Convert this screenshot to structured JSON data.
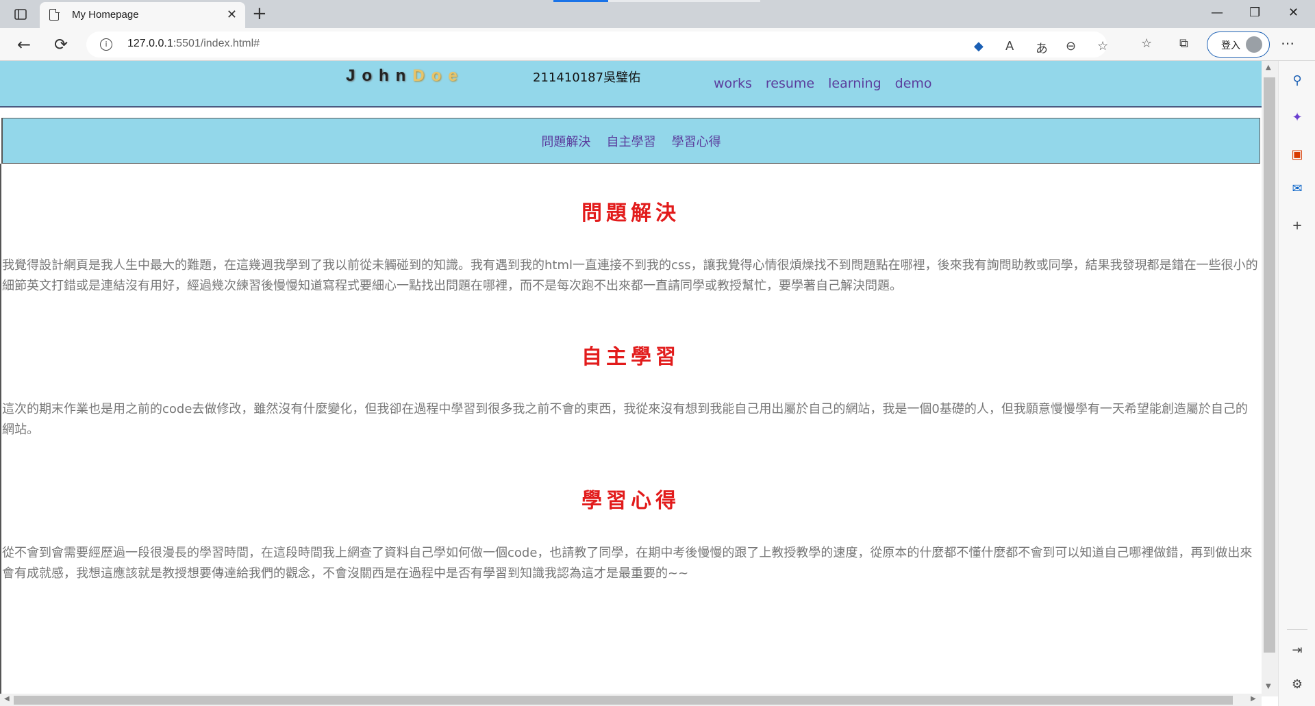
{
  "browser": {
    "tab_title": "My Homepage",
    "url_host": "127.0.0.1",
    "url_rest": ":5501/index.html#",
    "login_label": "登入"
  },
  "site": {
    "logo_main": "John",
    "logo_accent": "Doe",
    "student": "211410187吳璧佑",
    "nav": [
      "works",
      "resume",
      "learning",
      "demo"
    ],
    "subnav": [
      "問題解決",
      "自主學習",
      "學習心得"
    ]
  },
  "sections": [
    {
      "title": "問題解決",
      "text": "我覺得設計網頁是我人生中最大的難題，在這幾週我學到了我以前從未觸碰到的知識。我有遇到我的html一直連接不到我的css，讓我覺得心情很煩燥找不到問題點在哪裡，後來我有詢問助教或同學，結果我發現都是錯在一些很小的細節英文打錯或是連結沒有用好，經過幾次練習後慢慢知道寫程式要細心一點找出問題在哪裡，而不是每次跑不出來都一直請同學或教授幫忙，要學著自己解決問題。"
    },
    {
      "title": "自主學習",
      "text": "這次的期末作業也是用之前的code去做修改，雖然沒有什麼變化，但我卻在過程中學習到很多我之前不會的東西，我從來沒有想到我能自己用出屬於自己的網站，我是一個0基礎的人，但我願意慢慢學有一天希望能創造屬於自己的網站。"
    },
    {
      "title": "學習心得",
      "text": "從不會到會需要經歷過一段很漫長的學習時間，在這段時間我上網查了資料自己學如何做一個code，也請教了同學，在期中考後慢慢的跟了上教授教學的速度，從原本的什麼都不懂什麼都不會到可以知道自己哪裡做錯，再到做出來會有成就感，我想這應該就是教授想要傳達給我們的觀念，不會沒關西是在過程中是否有學習到知識我認為這才是最重要的~~"
    }
  ]
}
